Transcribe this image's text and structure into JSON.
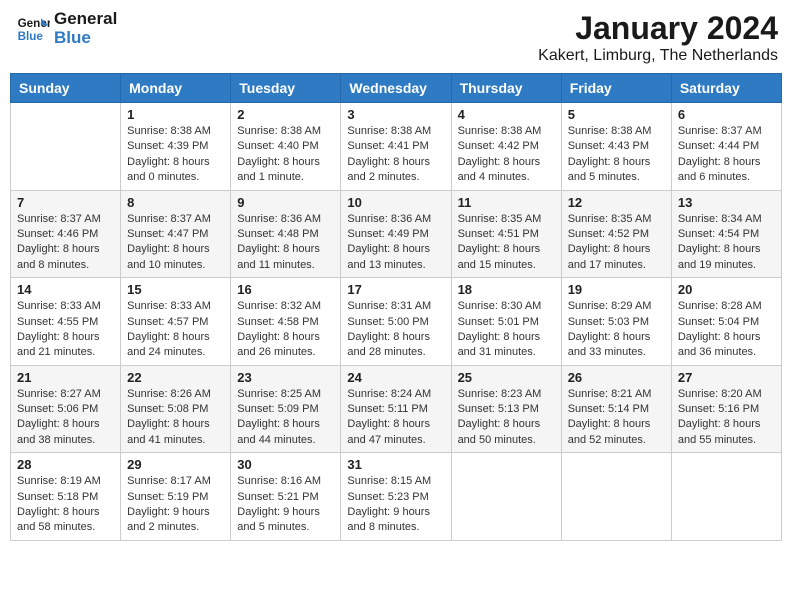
{
  "header": {
    "logo_line1": "General",
    "logo_line2": "Blue",
    "month_title": "January 2024",
    "location": "Kakert, Limburg, The Netherlands"
  },
  "weekdays": [
    "Sunday",
    "Monday",
    "Tuesday",
    "Wednesday",
    "Thursday",
    "Friday",
    "Saturday"
  ],
  "weeks": [
    [
      {
        "day": "",
        "info": ""
      },
      {
        "day": "1",
        "info": "Sunrise: 8:38 AM\nSunset: 4:39 PM\nDaylight: 8 hours\nand 0 minutes."
      },
      {
        "day": "2",
        "info": "Sunrise: 8:38 AM\nSunset: 4:40 PM\nDaylight: 8 hours\nand 1 minute."
      },
      {
        "day": "3",
        "info": "Sunrise: 8:38 AM\nSunset: 4:41 PM\nDaylight: 8 hours\nand 2 minutes."
      },
      {
        "day": "4",
        "info": "Sunrise: 8:38 AM\nSunset: 4:42 PM\nDaylight: 8 hours\nand 4 minutes."
      },
      {
        "day": "5",
        "info": "Sunrise: 8:38 AM\nSunset: 4:43 PM\nDaylight: 8 hours\nand 5 minutes."
      },
      {
        "day": "6",
        "info": "Sunrise: 8:37 AM\nSunset: 4:44 PM\nDaylight: 8 hours\nand 6 minutes."
      }
    ],
    [
      {
        "day": "7",
        "info": "Sunrise: 8:37 AM\nSunset: 4:46 PM\nDaylight: 8 hours\nand 8 minutes."
      },
      {
        "day": "8",
        "info": "Sunrise: 8:37 AM\nSunset: 4:47 PM\nDaylight: 8 hours\nand 10 minutes."
      },
      {
        "day": "9",
        "info": "Sunrise: 8:36 AM\nSunset: 4:48 PM\nDaylight: 8 hours\nand 11 minutes."
      },
      {
        "day": "10",
        "info": "Sunrise: 8:36 AM\nSunset: 4:49 PM\nDaylight: 8 hours\nand 13 minutes."
      },
      {
        "day": "11",
        "info": "Sunrise: 8:35 AM\nSunset: 4:51 PM\nDaylight: 8 hours\nand 15 minutes."
      },
      {
        "day": "12",
        "info": "Sunrise: 8:35 AM\nSunset: 4:52 PM\nDaylight: 8 hours\nand 17 minutes."
      },
      {
        "day": "13",
        "info": "Sunrise: 8:34 AM\nSunset: 4:54 PM\nDaylight: 8 hours\nand 19 minutes."
      }
    ],
    [
      {
        "day": "14",
        "info": "Sunrise: 8:33 AM\nSunset: 4:55 PM\nDaylight: 8 hours\nand 21 minutes."
      },
      {
        "day": "15",
        "info": "Sunrise: 8:33 AM\nSunset: 4:57 PM\nDaylight: 8 hours\nand 24 minutes."
      },
      {
        "day": "16",
        "info": "Sunrise: 8:32 AM\nSunset: 4:58 PM\nDaylight: 8 hours\nand 26 minutes."
      },
      {
        "day": "17",
        "info": "Sunrise: 8:31 AM\nSunset: 5:00 PM\nDaylight: 8 hours\nand 28 minutes."
      },
      {
        "day": "18",
        "info": "Sunrise: 8:30 AM\nSunset: 5:01 PM\nDaylight: 8 hours\nand 31 minutes."
      },
      {
        "day": "19",
        "info": "Sunrise: 8:29 AM\nSunset: 5:03 PM\nDaylight: 8 hours\nand 33 minutes."
      },
      {
        "day": "20",
        "info": "Sunrise: 8:28 AM\nSunset: 5:04 PM\nDaylight: 8 hours\nand 36 minutes."
      }
    ],
    [
      {
        "day": "21",
        "info": "Sunrise: 8:27 AM\nSunset: 5:06 PM\nDaylight: 8 hours\nand 38 minutes."
      },
      {
        "day": "22",
        "info": "Sunrise: 8:26 AM\nSunset: 5:08 PM\nDaylight: 8 hours\nand 41 minutes."
      },
      {
        "day": "23",
        "info": "Sunrise: 8:25 AM\nSunset: 5:09 PM\nDaylight: 8 hours\nand 44 minutes."
      },
      {
        "day": "24",
        "info": "Sunrise: 8:24 AM\nSunset: 5:11 PM\nDaylight: 8 hours\nand 47 minutes."
      },
      {
        "day": "25",
        "info": "Sunrise: 8:23 AM\nSunset: 5:13 PM\nDaylight: 8 hours\nand 50 minutes."
      },
      {
        "day": "26",
        "info": "Sunrise: 8:21 AM\nSunset: 5:14 PM\nDaylight: 8 hours\nand 52 minutes."
      },
      {
        "day": "27",
        "info": "Sunrise: 8:20 AM\nSunset: 5:16 PM\nDaylight: 8 hours\nand 55 minutes."
      }
    ],
    [
      {
        "day": "28",
        "info": "Sunrise: 8:19 AM\nSunset: 5:18 PM\nDaylight: 8 hours\nand 58 minutes."
      },
      {
        "day": "29",
        "info": "Sunrise: 8:17 AM\nSunset: 5:19 PM\nDaylight: 9 hours\nand 2 minutes."
      },
      {
        "day": "30",
        "info": "Sunrise: 8:16 AM\nSunset: 5:21 PM\nDaylight: 9 hours\nand 5 minutes."
      },
      {
        "day": "31",
        "info": "Sunrise: 8:15 AM\nSunset: 5:23 PM\nDaylight: 9 hours\nand 8 minutes."
      },
      {
        "day": "",
        "info": ""
      },
      {
        "day": "",
        "info": ""
      },
      {
        "day": "",
        "info": ""
      }
    ]
  ]
}
